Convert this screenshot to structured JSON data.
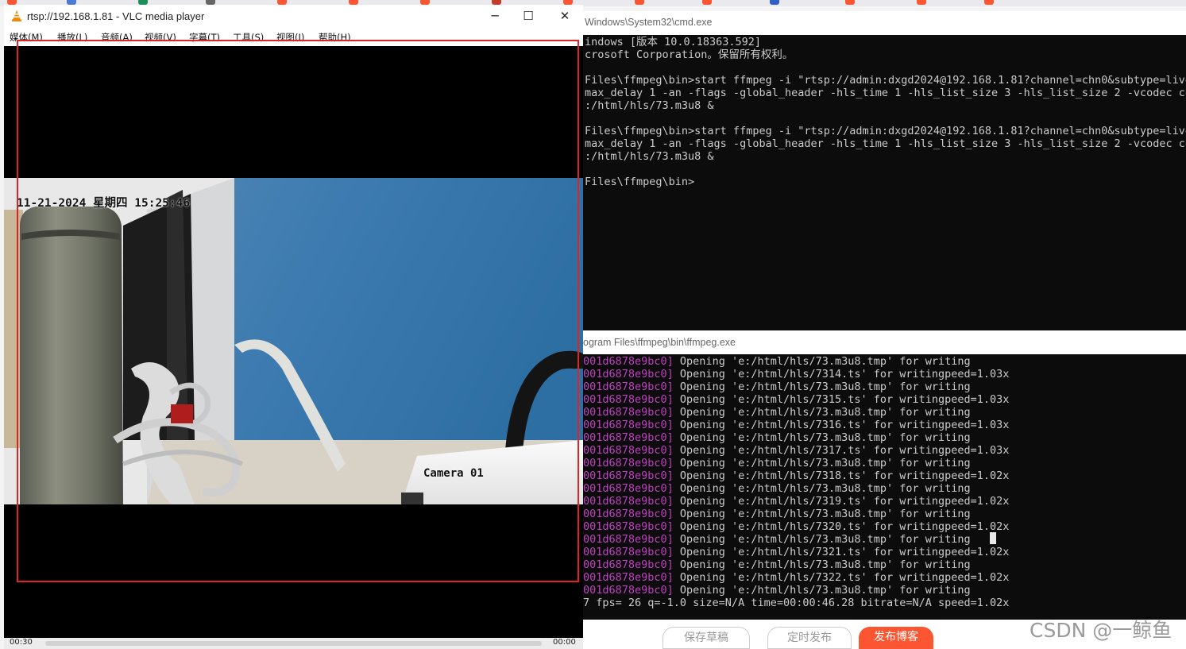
{
  "vlc": {
    "title": "rtsp://192.168.1.81 - VLC media player",
    "menu": [
      "媒体(M)",
      "播放(L)",
      "音频(A)",
      "视频(V)",
      "字幕(T)",
      "工具(S)",
      "视图(I)",
      "帮助(H)"
    ],
    "window_controls": {
      "minimize": "─",
      "maximize": "☐",
      "close": "✕"
    },
    "overlay_timestamp": "11-21-2024 星期四 15:25:46",
    "overlay_camera": "Camera 01",
    "time_elapsed": "00:30",
    "time_total": "00:00",
    "progress": 0
  },
  "cmd1": {
    "title": "Windows\\System32\\cmd.exe",
    "lines": [
      "indows [版本 10.0.18363.592]",
      "crosoft Corporation。保留所有权利。",
      "",
      "Files\\ffmpeg\\bin>start ffmpeg -i \"rtsp://admin:dxgd2024@192.168.1.81?channel=chn0&subtype=live\"",
      "max_delay 1 -an -flags -global_header -hls_time 1 -hls_list_size 3 -hls_list_size 2 -vcodec copy",
      ":/html/hls/73.m3u8 &",
      "",
      "Files\\ffmpeg\\bin>start ffmpeg -i \"rtsp://admin:dxgd2024@192.168.1.81?channel=chn0&subtype=live\"",
      "max_delay 1 -an -flags -global_header -hls_time 1 -hls_list_size 3 -hls_list_size 2 -vcodec copy",
      ":/html/hls/73.m3u8 &",
      "",
      "Files\\ffmpeg\\bin>"
    ]
  },
  "cmd2": {
    "title": "ogram Files\\ffmpeg\\bin\\ffmpeg.exe",
    "log_tag": "001d6878e9bc0]",
    "log_lines": [
      " Opening 'e:/html/hls/73.m3u8.tmp' for writing",
      " Opening 'e:/html/hls/7314.ts' for writingpeed=1.03x",
      " Opening 'e:/html/hls/73.m3u8.tmp' for writing",
      " Opening 'e:/html/hls/7315.ts' for writingpeed=1.03x",
      " Opening 'e:/html/hls/73.m3u8.tmp' for writing",
      " Opening 'e:/html/hls/7316.ts' for writingpeed=1.03x",
      " Opening 'e:/html/hls/73.m3u8.tmp' for writing",
      " Opening 'e:/html/hls/7317.ts' for writingpeed=1.03x",
      " Opening 'e:/html/hls/73.m3u8.tmp' for writing",
      " Opening 'e:/html/hls/7318.ts' for writingpeed=1.02x",
      " Opening 'e:/html/hls/73.m3u8.tmp' for writing",
      " Opening 'e:/html/hls/7319.ts' for writingpeed=1.02x",
      " Opening 'e:/html/hls/73.m3u8.tmp' for writing",
      " Opening 'e:/html/hls/7320.ts' for writingpeed=1.02x",
      " Opening 'e:/html/hls/73.m3u8.tmp' for writing",
      " Opening 'e:/html/hls/7321.ts' for writingpeed=1.02x",
      " Opening 'e:/html/hls/73.m3u8.tmp' for writing",
      " Opening 'e:/html/hls/7322.ts' for writingpeed=1.02x",
      " Opening 'e:/html/hls/73.m3u8.tmp' for writing"
    ],
    "status_line": "7 fps= 26 q=-1.0 size=N/A time=00:00:46.28 bitrate=N/A speed=1.02x"
  },
  "webpage": {
    "buttons": [
      "保存草稿",
      "定时发布",
      "发布博客"
    ],
    "watermark": "CSDN @一鲸鱼"
  },
  "colors": {
    "highlight_box": "#e02424",
    "log_tag": "#c23ec2",
    "publish_button": "#fc5531"
  }
}
